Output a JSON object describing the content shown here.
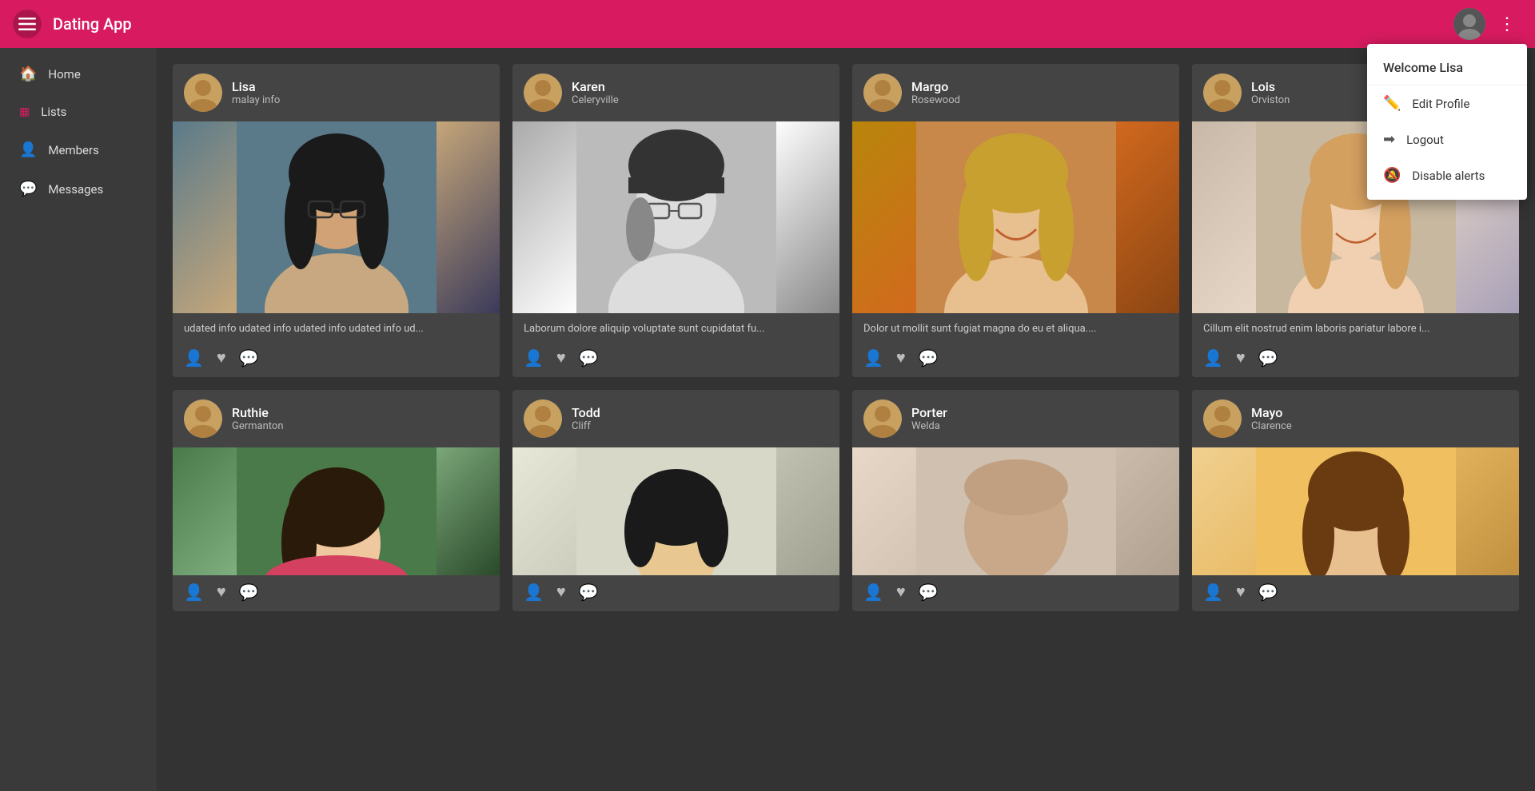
{
  "app": {
    "title": "Dating App"
  },
  "topbar": {
    "title": "Dating App",
    "welcome": "Welcome Lisa",
    "menu_icon": "☰",
    "dots_icon": "⋮"
  },
  "sidebar": {
    "items": [
      {
        "id": "home",
        "label": "Home",
        "icon": "🏠",
        "iconClass": "home"
      },
      {
        "id": "lists",
        "label": "Lists",
        "icon": "☰",
        "iconClass": "lists"
      },
      {
        "id": "members",
        "label": "Members",
        "icon": "👤",
        "iconClass": "members"
      },
      {
        "id": "messages",
        "label": "Messages",
        "icon": "💬",
        "iconClass": "messages"
      }
    ]
  },
  "dropdown": {
    "welcome": "Welcome Lisa",
    "items": [
      {
        "id": "edit-profile",
        "label": "Edit Profile",
        "icon": "✏️"
      },
      {
        "id": "logout",
        "label": "Logout",
        "icon": "➡️"
      },
      {
        "id": "disable-alerts",
        "label": "Disable alerts",
        "icon": "🔔"
      }
    ]
  },
  "members": [
    {
      "id": "lisa",
      "name": "Lisa",
      "location": "malay info",
      "bio": "udated info udated info udated info udated info ud...",
      "photoClass": "photo-lisa"
    },
    {
      "id": "karen",
      "name": "Karen",
      "location": "Celeryville",
      "bio": "Laborum dolore aliquip voluptate sunt cupidatat fu...",
      "photoClass": "photo-karen"
    },
    {
      "id": "margo",
      "name": "Margo",
      "location": "Rosewood",
      "bio": "Dolor ut mollit sunt fugiat magna do eu et aliqua....",
      "photoClass": "photo-margo"
    },
    {
      "id": "lois",
      "name": "Lois",
      "location": "Orviston",
      "bio": "Cillum elit nostrud enim laboris pariatur labore i...",
      "photoClass": "photo-lois"
    },
    {
      "id": "ruthie",
      "name": "Ruthie",
      "location": "Germanton",
      "bio": "",
      "photoClass": "photo-ruthie"
    },
    {
      "id": "todd",
      "name": "Todd",
      "location": "Cliff",
      "bio": "",
      "photoClass": "photo-todd"
    },
    {
      "id": "porter",
      "name": "Porter",
      "location": "Welda",
      "bio": "",
      "photoClass": "photo-porter"
    },
    {
      "id": "mayo",
      "name": "Mayo",
      "location": "Clarence",
      "bio": "",
      "photoClass": "photo-mayo"
    }
  ],
  "colors": {
    "brand": "#d81b60",
    "sidebar_bg": "#3a3a3a",
    "card_bg": "#444",
    "topbar": "#d81b60"
  }
}
